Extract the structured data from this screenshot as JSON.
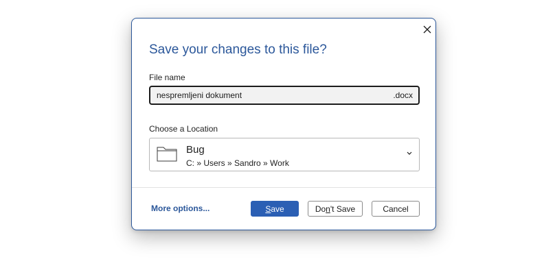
{
  "dialog": {
    "title": "Save your changes to this file?",
    "close_icon": "close-icon",
    "file_name": {
      "label": "File name",
      "value": "nespremljeni dokument",
      "extension": ".docx"
    },
    "location": {
      "label": "Choose a Location",
      "icon": "folder-icon",
      "name": "Bug",
      "path": "C: » Users » Sandro » Work",
      "chevron_icon": "chevron-down-icon"
    },
    "footer": {
      "more_options": "More options...",
      "save": {
        "accel": "S",
        "rest": "ave"
      },
      "dont_save": {
        "pre": "Do",
        "accel": "n",
        "rest": "'t Save"
      },
      "cancel": "Cancel"
    }
  },
  "colors": {
    "accent": "#2b579a",
    "primary_button": "#2b5fb4"
  }
}
